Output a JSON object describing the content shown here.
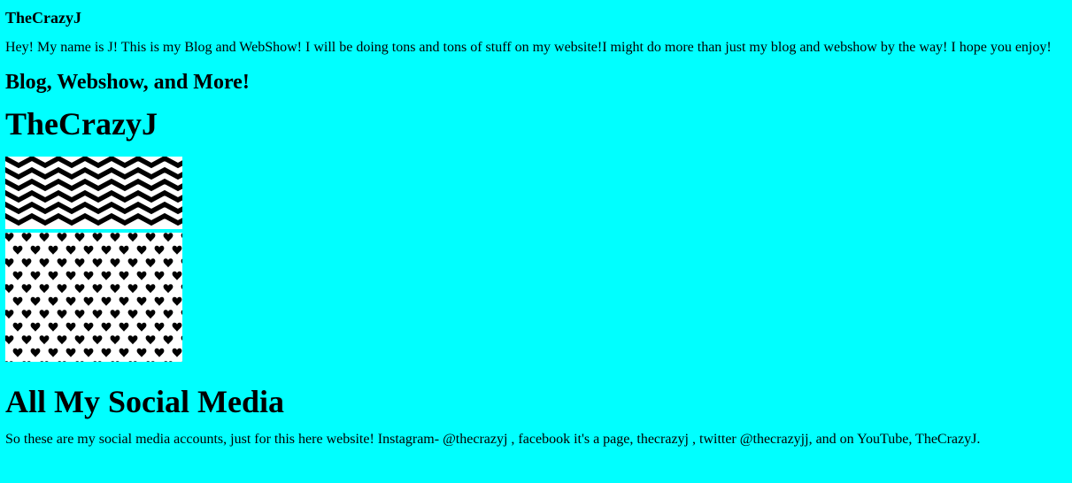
{
  "header": {
    "site_name": "TheCrazyJ",
    "intro": "Hey! My name is J! This is my Blog and WebShow! I will be doing tons and tons of stuff on my website!I might do more than just my blog and webshow by the way! I hope you enjoy!",
    "tagline": "Blog, Webshow, and More!",
    "title": "TheCrazyJ"
  },
  "images": [
    {
      "pattern": "chevron-zigzag"
    },
    {
      "pattern": "heart-polka"
    }
  ],
  "social": {
    "heading": "All My Social Media",
    "text": "So these are my social media accounts, just for this here website! Instagram- @thecrazyj , facebook it's a page, thecrazyj , twitter @thecrazyjj, and on YouTube, TheCrazyJ."
  },
  "colors": {
    "background": "#00ffff",
    "text": "#000000"
  }
}
